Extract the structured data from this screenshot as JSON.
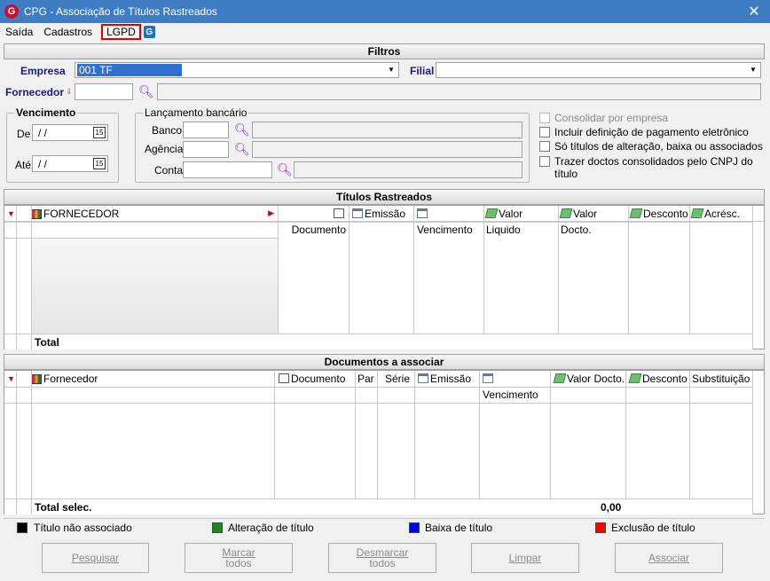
{
  "window": {
    "title": "CPG - Associação de Títulos Rastreados",
    "logo": "G",
    "close": "✕"
  },
  "menu": {
    "items": [
      "Saída",
      "Cadastros",
      "LGPD"
    ],
    "active": "LGPD",
    "help_icon": "G"
  },
  "filters": {
    "header": "Filtros",
    "empresa_label": "Empresa",
    "empresa_value": "001 TF",
    "filial_label": "Filial",
    "filial_value": "",
    "fornecedor_label": "Fornecedor",
    "fornecedor_code": "",
    "fornecedor_name": "",
    "vencimento": {
      "title": "Vencimento",
      "de_label": "De",
      "de_value": " /  /",
      "ate_label": "Até",
      "ate_value": " /  /",
      "cal_icon": "15"
    },
    "lancamento": {
      "title": "Lançamento bancário",
      "banco_label": "Banco",
      "agencia_label": "Agência",
      "conta_label": "Conta"
    },
    "options": [
      {
        "label": "Consolidar por empresa",
        "checked": false,
        "enabled": false
      },
      {
        "label": "Incluir definição de pagamento eletrônico",
        "checked": false,
        "enabled": true
      },
      {
        "label": "Só títulos de alteração, baixa ou associados",
        "checked": false,
        "enabled": true
      },
      {
        "label": "Trazer doctos consolidados pelo CNPJ do título",
        "checked": false,
        "enabled": true
      }
    ]
  },
  "titulos": {
    "header": "Títulos Rastreados",
    "columns": [
      "FORNECEDOR",
      "Documento",
      "Emissão",
      "Vencimento",
      "Valor Liquido",
      "Valor Docto.",
      "Desconto",
      "Acrésc."
    ],
    "total_label": "Total"
  },
  "documentos": {
    "header": "Documentos a associar",
    "columns": [
      "Fornecedor",
      "Documento",
      "Par",
      "Série",
      "Emissão",
      "Vencimento",
      "Valor Docto.",
      "Desconto",
      "Substituição"
    ],
    "total_label": "Total selec.",
    "total_value": "0,00"
  },
  "legend": [
    {
      "label": "Título não associado",
      "color": "#000000"
    },
    {
      "label": "Alteração de título",
      "color": "#1a8a1a"
    },
    {
      "label": "Baixa de título",
      "color": "#0000ff"
    },
    {
      "label": "Exclusão de título",
      "color": "#ff0000"
    }
  ],
  "buttons": {
    "pesquisar": "Pesquisar",
    "marcar_1": "Marcar",
    "marcar_2": "todos",
    "desmarcar_1": "Desmarcar",
    "desmarcar_2": "todos",
    "limpar": "Limpar",
    "associar": "Associar"
  }
}
